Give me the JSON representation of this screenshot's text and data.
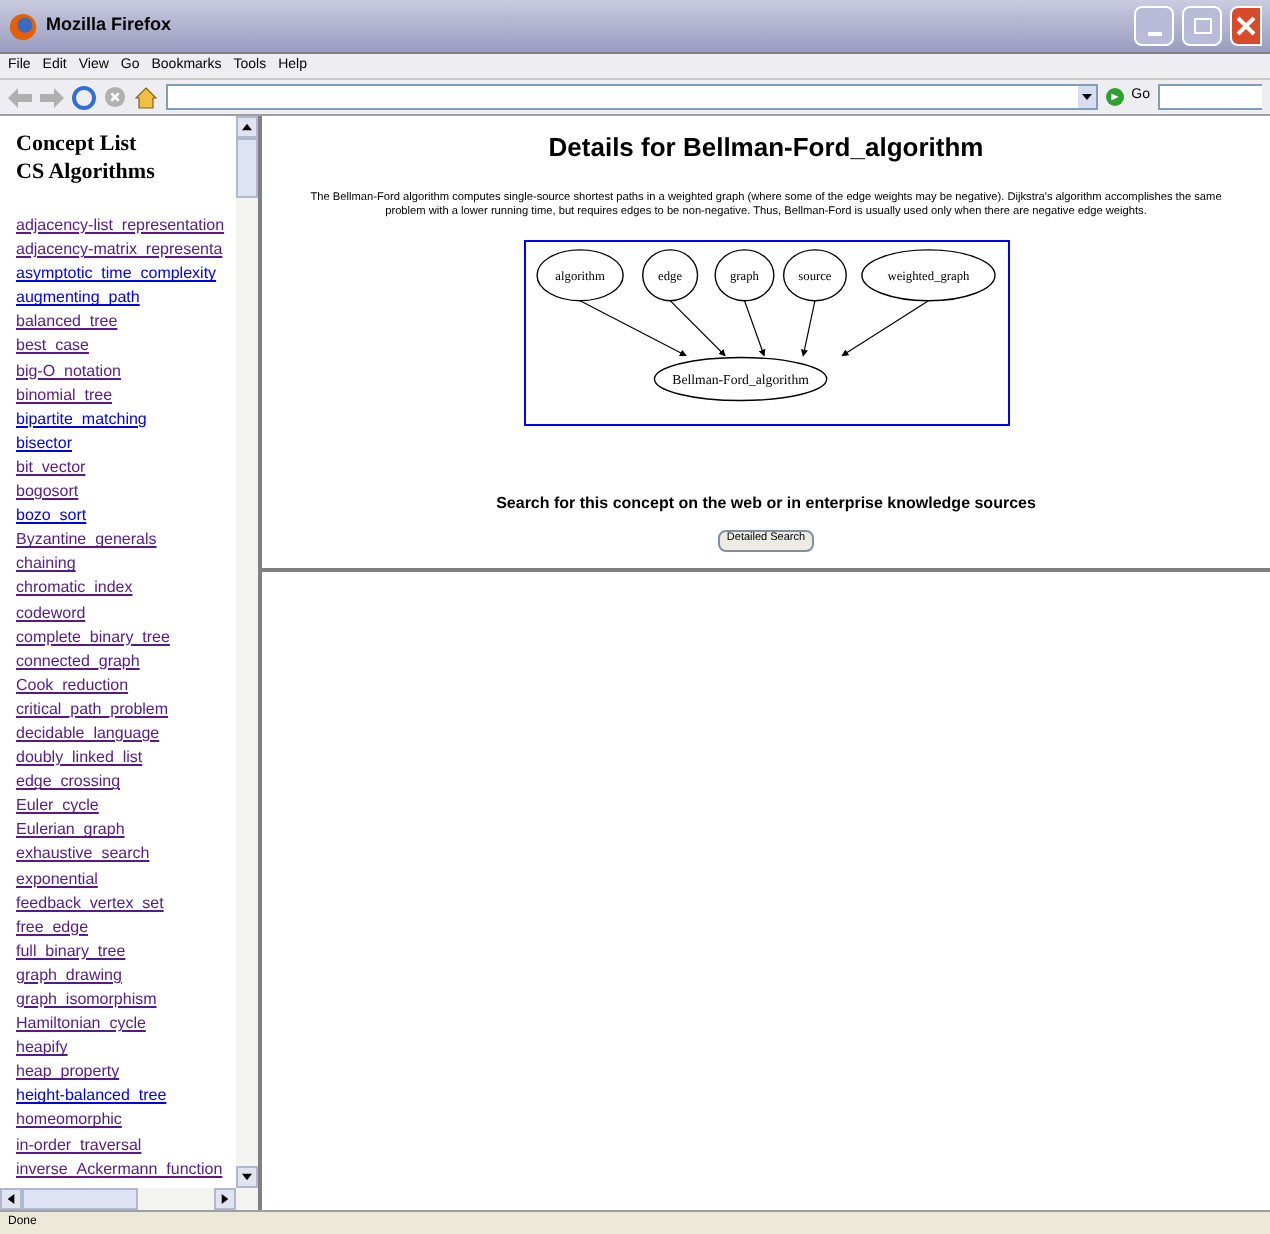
{
  "window": {
    "title": "Mozilla Firefox"
  },
  "menu": [
    "File",
    "Edit",
    "View",
    "Go",
    "Bookmarks",
    "Tools",
    "Help"
  ],
  "toolbar": {
    "go_label": "Go"
  },
  "sidebar": {
    "title": "Concept List",
    "subtitle": "CS Algorithms",
    "links": [
      {
        "label": "adjacency-list_representation",
        "visited": true
      },
      {
        "label": "adjacency-matrix_representa",
        "visited": true
      },
      {
        "label": "asymptotic_time_complexity",
        "visited": false
      },
      {
        "label": "augmenting_path",
        "visited": false
      },
      {
        "label": "balanced_tree",
        "visited": true
      },
      {
        "label": "best_case",
        "visited": true
      },
      {
        "label": "big-O_notation",
        "visited": true
      },
      {
        "label": "binomial_tree",
        "visited": true
      },
      {
        "label": "bipartite_matching",
        "visited": false
      },
      {
        "label": "bisector",
        "visited": false
      },
      {
        "label": "bit_vector",
        "visited": true
      },
      {
        "label": "bogosort",
        "visited": true
      },
      {
        "label": "bozo_sort",
        "visited": false
      },
      {
        "label": "Byzantine_generals",
        "visited": true
      },
      {
        "label": "chaining",
        "visited": true
      },
      {
        "label": "chromatic_index",
        "visited": true
      },
      {
        "label": "codeword",
        "visited": true
      },
      {
        "label": "complete_binary_tree",
        "visited": true
      },
      {
        "label": "connected_graph",
        "visited": true
      },
      {
        "label": "Cook_reduction",
        "visited": true
      },
      {
        "label": "critical_path_problem",
        "visited": true
      },
      {
        "label": "decidable_language",
        "visited": true
      },
      {
        "label": "doubly_linked_list",
        "visited": true
      },
      {
        "label": "edge_crossing",
        "visited": true
      },
      {
        "label": "Euler_cycle",
        "visited": true
      },
      {
        "label": "Eulerian_graph",
        "visited": true
      },
      {
        "label": "exhaustive_search",
        "visited": true
      },
      {
        "label": "exponential",
        "visited": true
      },
      {
        "label": "feedback_vertex_set",
        "visited": true
      },
      {
        "label": "free_edge",
        "visited": true
      },
      {
        "label": "full_binary_tree",
        "visited": true
      },
      {
        "label": "graph_drawing",
        "visited": true
      },
      {
        "label": "graph_isomorphism",
        "visited": true
      },
      {
        "label": "Hamiltonian_cycle",
        "visited": true
      },
      {
        "label": "heapify",
        "visited": true
      },
      {
        "label": "heap_property",
        "visited": true
      },
      {
        "label": "height-balanced_tree",
        "visited": false
      },
      {
        "label": "homeomorphic",
        "visited": true
      },
      {
        "label": "in-order_traversal",
        "visited": true
      },
      {
        "label": "inverse_Ackermann_function",
        "visited": true
      }
    ]
  },
  "main": {
    "heading": "Details for Bellman-Ford_algorithm",
    "description": [
      "The Bellman-Ford algorithm computes single-source shortest paths in a weighted graph (where some of the edge weights may be negative). Dijkstra's algorithm accomplishes the same",
      "problem with a lower running time, but requires edges to be non-negative. Thus, Bellman-Ford is usually used only when there are negative edge weights."
    ],
    "graph": {
      "sources": [
        "algorithm",
        "edge",
        "graph",
        "source",
        "weighted_graph"
      ],
      "target": "Bellman-Ford_algorithm"
    },
    "search_prompt": "Search for this concept on the web or in enterprise knowledge sources",
    "search_button": "Detailed Search"
  },
  "status_bar": "Done"
}
